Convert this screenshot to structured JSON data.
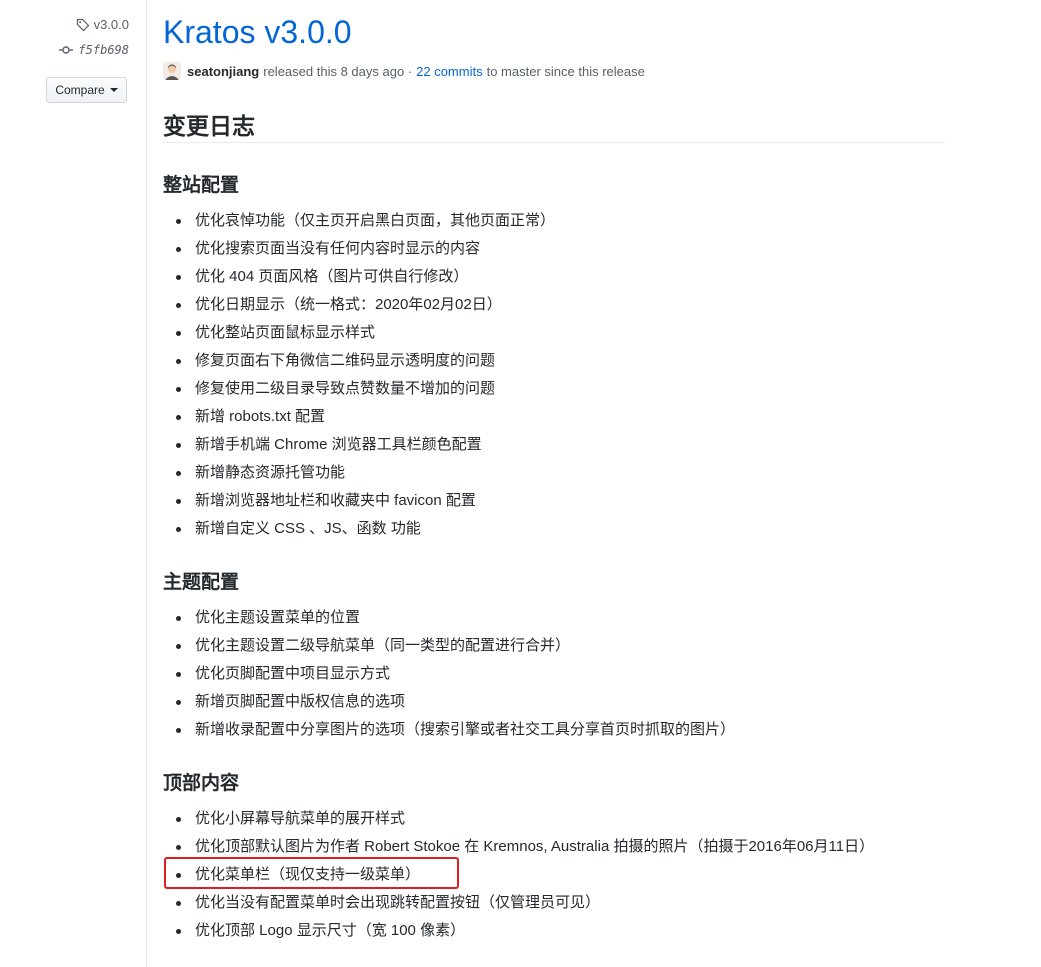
{
  "sidebar": {
    "tag": "v3.0.0",
    "commit": "f5fb698",
    "compare_label": "Compare"
  },
  "release": {
    "title": "Kratos v3.0.0",
    "author": "seatonjiang",
    "released_text": "released this 8 days ago ·",
    "commits_link": "22 commits",
    "since_text": "to master since this release"
  },
  "changelog": {
    "heading": "变更日志",
    "sections": [
      {
        "heading": "整站配置",
        "items": [
          "优化哀悼功能（仅主页开启黑白页面，其他页面正常）",
          "优化搜索页面当没有任何内容时显示的内容",
          "优化 404 页面风格（图片可供自行修改）",
          "优化日期显示（统一格式：2020年02月02日）",
          "优化整站页面鼠标显示样式",
          "修复页面右下角微信二维码显示透明度的问题",
          "修复使用二级目录导致点赞数量不增加的问题",
          "新增 robots.txt 配置",
          "新增手机端 Chrome 浏览器工具栏颜色配置",
          "新增静态资源托管功能",
          "新增浏览器地址栏和收藏夹中 favicon 配置",
          "新增自定义 CSS 、JS、函数 功能"
        ]
      },
      {
        "heading": "主题配置",
        "items": [
          "优化主题设置菜单的位置",
          "优化主题设置二级导航菜单（同一类型的配置进行合并）",
          "优化页脚配置中项目显示方式",
          "新增页脚配置中版权信息的选项",
          "新增收录配置中分享图片的选项（搜索引擎或者社交工具分享首页时抓取的图片）"
        ]
      },
      {
        "heading": "顶部内容",
        "items": [
          "优化小屏幕导航菜单的展开样式",
          "优化顶部默认图片为作者 Robert Stokoe 在 Kremnos, Australia 拍摄的照片（拍摄于2016年06月11日）",
          "优化菜单栏（现仅支持一级菜单）",
          "优化当没有配置菜单时会出现跳转配置按钮（仅管理员可见）",
          "优化顶部 Logo 显示尺寸（宽 100 像素）"
        ]
      }
    ]
  },
  "colors": {
    "link": "#0366d6",
    "highlight": "#e01b24"
  }
}
